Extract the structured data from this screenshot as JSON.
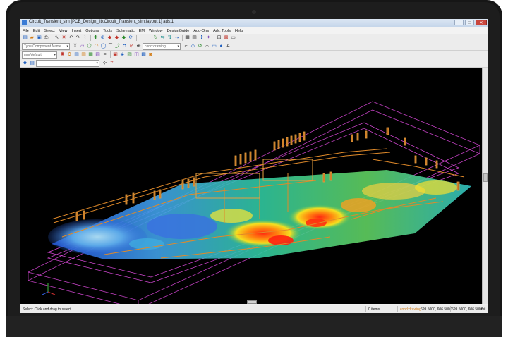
{
  "window": {
    "title": "Circuit_Transient_sim [PCB_Design_lib:Circuit_Transient_sim:layout:1] ads:1",
    "controls": {
      "minimize": "–",
      "maximize": "□",
      "close": "✕"
    }
  },
  "menu": [
    "File",
    "Edit",
    "Select",
    "View",
    "Insert",
    "Options",
    "Tools",
    "Schematic",
    "EM",
    "Window",
    "DesignGuide",
    "Add-Ons",
    "Adv. Tools",
    "Help"
  ],
  "toolbar": {
    "component_search_placeholder": "Type Component Name",
    "layer_combo_value": "cond:drawing",
    "units_combo_value": "mm/default"
  },
  "statusbar": {
    "hint": "Select: Click and drag to select.",
    "items_count": "0 items",
    "layer": "cond:drawing",
    "coord1": "699.5000, 606.5000",
    "coord2": "699.5000, 606.5000",
    "units": "mil"
  },
  "colors": {
    "canvas": "#000000",
    "board_outline": "#d94ad9",
    "traces": "#e08a2a",
    "hot": "#e03a1a",
    "cool": "#2a5fd8"
  }
}
